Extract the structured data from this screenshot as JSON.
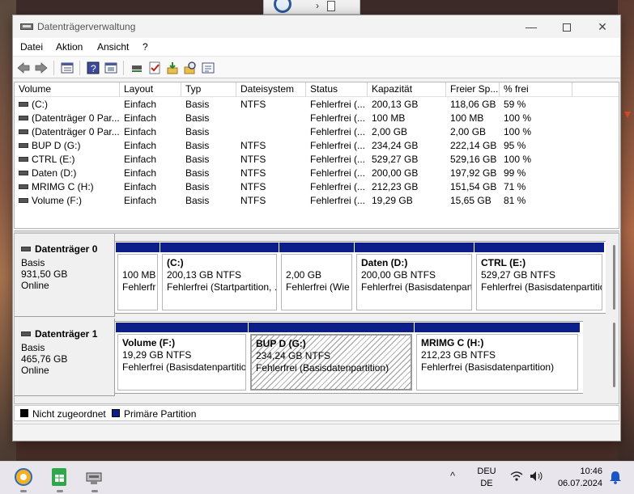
{
  "window": {
    "title": "Datenträgerverwaltung",
    "minimize_glyph": "—",
    "close_glyph": "✕"
  },
  "menu": [
    "Datei",
    "Aktion",
    "Ansicht",
    "?"
  ],
  "toolbar_icons": [
    "back-arrow-icon",
    "forward-arrow-icon",
    "list-view-icon",
    "help-icon",
    "properties-icon",
    "connect-icon",
    "checkmark-icon",
    "import-icon",
    "search-icon",
    "details-icon"
  ],
  "volume_list": {
    "columns": [
      "Volume",
      "Layout",
      "Typ",
      "Dateisystem",
      "Status",
      "Kapazität",
      "Freier Sp...",
      "% frei"
    ],
    "rows": [
      [
        "(C:)",
        "Einfach",
        "Basis",
        "NTFS",
        "Fehlerfrei (...",
        "200,13 GB",
        "118,06 GB",
        "59 %"
      ],
      [
        "(Datenträger 0 Par...",
        "Einfach",
        "Basis",
        "",
        "Fehlerfrei (...",
        "100 MB",
        "100 MB",
        "100 %"
      ],
      [
        "(Datenträger 0 Par...",
        "Einfach",
        "Basis",
        "",
        "Fehlerfrei (...",
        "2,00 GB",
        "2,00 GB",
        "100 %"
      ],
      [
        "BUP D (G:)",
        "Einfach",
        "Basis",
        "NTFS",
        "Fehlerfrei (...",
        "234,24 GB",
        "222,14 GB",
        "95 %"
      ],
      [
        "CTRL (E:)",
        "Einfach",
        "Basis",
        "NTFS",
        "Fehlerfrei (...",
        "529,27 GB",
        "529,16 GB",
        "100 %"
      ],
      [
        "Daten (D:)",
        "Einfach",
        "Basis",
        "NTFS",
        "Fehlerfrei (...",
        "200,00 GB",
        "197,92 GB",
        "99 %"
      ],
      [
        "MRIMG C (H:)",
        "Einfach",
        "Basis",
        "NTFS",
        "Fehlerfrei (...",
        "212,23 GB",
        "151,54 GB",
        "71 %"
      ],
      [
        "Volume (F:)",
        "Einfach",
        "Basis",
        "NTFS",
        "Fehlerfrei (...",
        "19,29 GB",
        "15,65 GB",
        "81 %"
      ]
    ]
  },
  "disks": [
    {
      "name": "Datenträger 0",
      "type": "Basis",
      "size": "931,50 GB",
      "state": "Online",
      "partitions": [
        {
          "name": "",
          "size": "100 MB",
          "status": "Fehlerfr",
          "hatched": false
        },
        {
          "name": "(C:)",
          "size": "200,13 GB NTFS",
          "status": "Fehlerfrei (Startpartition, ...",
          "hatched": false
        },
        {
          "name": "",
          "size": "2,00 GB",
          "status": "Fehlerfrei (Wie",
          "hatched": false
        },
        {
          "name": "Daten  (D:)",
          "size": "200,00 GB NTFS",
          "status": "Fehlerfrei (Basisdatenpart",
          "hatched": false
        },
        {
          "name": "CTRL  (E:)",
          "size": "529,27 GB NTFS",
          "status": "Fehlerfrei (Basisdatenpartitio",
          "hatched": false
        }
      ]
    },
    {
      "name": "Datenträger 1",
      "type": "Basis",
      "size": "465,76 GB",
      "state": "Online",
      "partitions": [
        {
          "name": "Volume  (F:)",
          "size": "19,29 GB NTFS",
          "status": "Fehlerfrei (Basisdatenpartitio",
          "hatched": false
        },
        {
          "name": "BUP D  (G:)",
          "size": "234,24 GB NTFS",
          "status": "Fehlerfrei (Basisdatenpartition)",
          "hatched": true
        },
        {
          "name": "MRIMG C  (H:)",
          "size": "212,23 GB NTFS",
          "status": "Fehlerfrei (Basisdatenpartition)",
          "hatched": false
        }
      ]
    }
  ],
  "legend": [
    {
      "label": "Nicht zugeordnet",
      "color": "#000000"
    },
    {
      "label": "Primäre Partition",
      "color": "#0b1e8a"
    }
  ],
  "colors": {
    "primary_partition": "#0b1e8a",
    "unallocated": "#000000"
  },
  "taskbar": {
    "language_top": "DEU",
    "language_bottom": "DE",
    "time": "10:46",
    "date": "06.07.2024",
    "chevron": "^"
  }
}
